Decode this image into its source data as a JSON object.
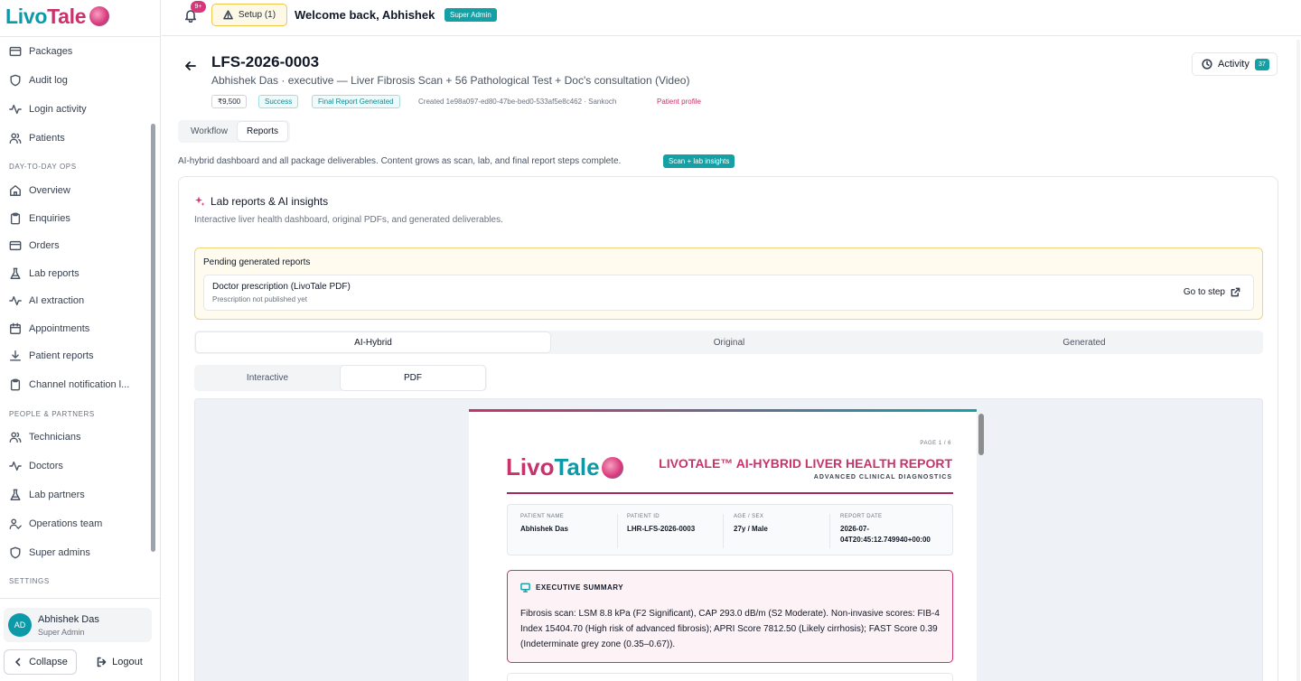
{
  "app": {
    "logo_part1": "Livo",
    "logo_part2": "Tale"
  },
  "sidebar": {
    "items_top": [
      {
        "label": "Packages",
        "icon": "package-icon"
      },
      {
        "label": "Audit log",
        "icon": "shield-icon"
      },
      {
        "label": "Login activity",
        "icon": "activity-icon"
      },
      {
        "label": "Patients",
        "icon": "users-icon"
      }
    ],
    "section_ops": "DAY-TO-DAY OPS",
    "items_ops": [
      {
        "label": "Overview",
        "icon": "home-icon"
      },
      {
        "label": "Enquiries",
        "icon": "clipboard-icon"
      },
      {
        "label": "Orders",
        "icon": "package-icon"
      },
      {
        "label": "Lab reports",
        "icon": "flask-icon"
      },
      {
        "label": "AI extraction",
        "icon": "activity-icon"
      },
      {
        "label": "Appointments",
        "icon": "calendar-icon"
      },
      {
        "label": "Patient reports",
        "icon": "download-icon"
      },
      {
        "label": "Channel notification l...",
        "icon": "clipboard-icon"
      }
    ],
    "section_people": "PEOPLE & PARTNERS",
    "items_people": [
      {
        "label": "Technicians",
        "icon": "users-icon"
      },
      {
        "label": "Doctors",
        "icon": "activity-icon"
      },
      {
        "label": "Lab partners",
        "icon": "flask-icon"
      },
      {
        "label": "Operations team",
        "icon": "user-check-icon"
      },
      {
        "label": "Super admins",
        "icon": "shield-icon"
      }
    ],
    "section_settings": "SETTINGS",
    "user": {
      "initials": "AD",
      "name": "Abhishek Das",
      "role": "Super Admin"
    },
    "collapse_label": "Collapse",
    "logout_label": "Logout"
  },
  "topbar": {
    "notification_count": "9+",
    "setup_label": "Setup (1)",
    "welcome": "Welcome back, Abhishek",
    "role_badge": "Super Admin"
  },
  "order": {
    "id": "LFS-2026-0003",
    "subtitle": "Abhishek Das · executive — Liver Fibrosis Scan + 56 Pathological Test + Doc's consultation (Video)",
    "price": "₹9,500",
    "payment_status": "Success",
    "report_status": "Final Report Generated",
    "created": "Created 1e98a097-ed80-47be-bed0-533af5e8c462 · Sankoch",
    "patient_link": "Patient profile",
    "activity_label": "Activity",
    "activity_count": "37"
  },
  "tabs_top": [
    "Workflow",
    "Reports"
  ],
  "reports": {
    "description": "AI-hybrid dashboard and all package deliverables. Content grows as scan, lab, and final report steps complete.",
    "insight_badge": "Scan + lab insights",
    "card_title": "Lab reports & AI insights",
    "card_subtitle": "Interactive liver health dashboard, original PDFs, and generated deliverables.",
    "pending": {
      "title": "Pending generated reports",
      "item_title": "Doctor prescription (LivoTale PDF)",
      "item_sub": "Prescription not published yet",
      "action": "Go to step"
    },
    "view_tabs": [
      "AI-Hybrid",
      "Original",
      "Generated"
    ],
    "format_tabs": [
      "Interactive",
      "PDF"
    ]
  },
  "pdf": {
    "page_no": "PAGE 1 / 6",
    "logo_part1": "Livo",
    "logo_part2": "Tale",
    "title": "LIVOTALE™ AI-HYBRID LIVER HEALTH REPORT",
    "subtitle": "ADVANCED CLINICAL DIAGNOSTICS",
    "info": [
      {
        "label": "PATIENT NAME",
        "value": "Abhishek Das"
      },
      {
        "label": "PATIENT ID",
        "value": "LHR-LFS-2026-0003"
      },
      {
        "label": "AGE / SEX",
        "value": "27y / Male"
      },
      {
        "label": "REPORT DATE",
        "value": "2026-07-04T20:45:12.749940+00:00"
      }
    ],
    "summary_heading": "EXECUTIVE SUMMARY",
    "summary_text": "Fibrosis scan: LSM 8.8 kPa (F2 Significant), CAP 293.0 dB/m (S2 Moderate). Non-invasive scores: FIB-4 Index 15404.70 (High risk of advanced fibrosis); APRI Score 7812.50 (Likely cirrhosis); FAST Score 0.39 (Indeterminate grey zone (0.35–0.67))."
  }
}
